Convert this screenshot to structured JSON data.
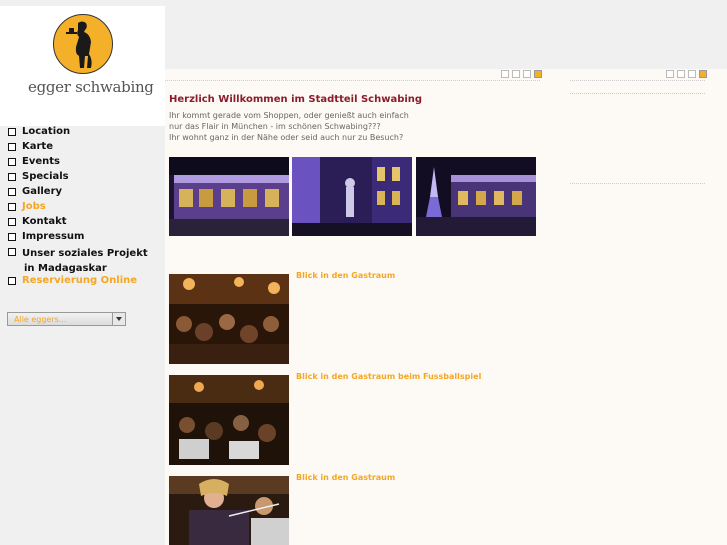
{
  "logo": {
    "text": "egger schwabing"
  },
  "nav": {
    "items": [
      {
        "label": "Location"
      },
      {
        "label": "Karte"
      },
      {
        "label": "Events"
      },
      {
        "label": "Specials"
      },
      {
        "label": "Gallery"
      },
      {
        "label": "Jobs",
        "active": true
      },
      {
        "label": "Kontakt"
      },
      {
        "label": "Impressum"
      },
      {
        "label": "Unser soziales Projekt",
        "label2": "in Madagaskar"
      },
      {
        "label": "Reservierung Online",
        "highlight": true
      }
    ]
  },
  "select": {
    "value": "Alle eggers..."
  },
  "main": {
    "title": "Herzlich Willkommen im Stadtteil Schwabing",
    "intro_lines": [
      "Ihr kommt gerade vom Shoppen, oder genießt auch einfach",
      "nur das Flair in München - im schönen Schwabing???",
      "Ihr wohnt ganz in der Nähe oder seid auch nur zu Besuch?"
    ]
  },
  "gallery": [
    {
      "caption": "Blick in den Gastraum"
    },
    {
      "caption": "Blick in den Gastraum beim Fussballspiel"
    },
    {
      "caption": "Blick in den Gastraum"
    }
  ],
  "colors": {
    "accent": "#f5a623",
    "title": "#8a1c2b",
    "active_page": "#f5b02a"
  },
  "pager": {
    "pages": 4,
    "active_page": 4
  }
}
